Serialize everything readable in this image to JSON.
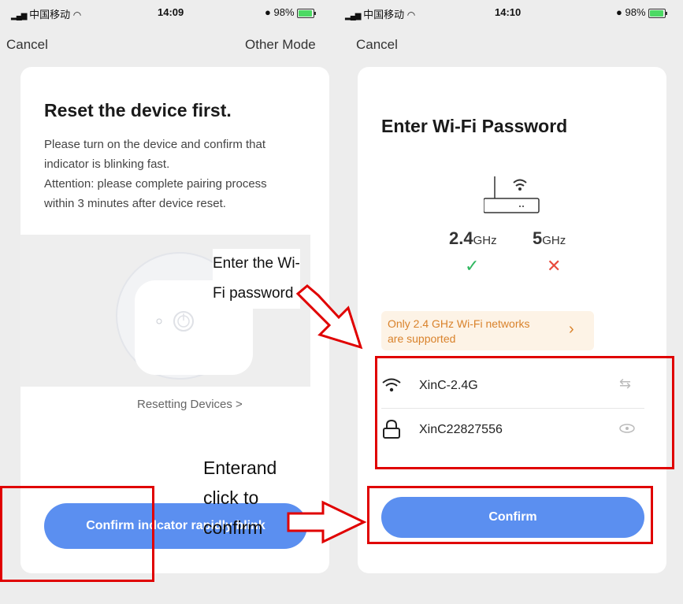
{
  "left": {
    "status": {
      "carrier": "中国移动",
      "time": "14:09",
      "battery": "98%"
    },
    "cancel": "Cancel",
    "other_mode": "Other Mode",
    "title": "Reset the device first.",
    "desc1": "Please turn on the device and confirm that",
    "desc2": "indicator is blinking fast.",
    "desc3": "Attention: please complete pairing process",
    "desc4": "within 3 minutes after device reset.",
    "resetting_link": "Resetting Devices >",
    "button_left": "Confirm ind",
    "button_right": "cator rapidly blink"
  },
  "right": {
    "status": {
      "carrier": "中国移动",
      "time": "14:10",
      "battery": "98%"
    },
    "cancel": "Cancel",
    "title": "Enter Wi-Fi Password",
    "band_24": "2.4",
    "band_24_unit": "GHz",
    "band_5": "5",
    "band_5_unit": "GHz",
    "check_24": "✓",
    "check_5": "✕",
    "notice1": "Only 2.4 GHz Wi-Fi networks",
    "notice2": "are supported",
    "notice_chevron": "›",
    "ssid": "XinC-2.4G",
    "password": "XinC22827556",
    "confirm": "Confirm"
  },
  "annotations": {
    "wifi_note_1": "Enter the Wi-",
    "wifi_note_2": "Fi password",
    "confirm_note_1": "Enterand",
    "confirm_note_2": "click to",
    "confirm_note_3": "confirm"
  },
  "colors": {
    "accent": "#5b8ff0",
    "annotation_red": "#e00000",
    "check_green": "#2fb75f",
    "cross_red": "#e84a3c",
    "notice_bg": "#fdf3e6"
  }
}
